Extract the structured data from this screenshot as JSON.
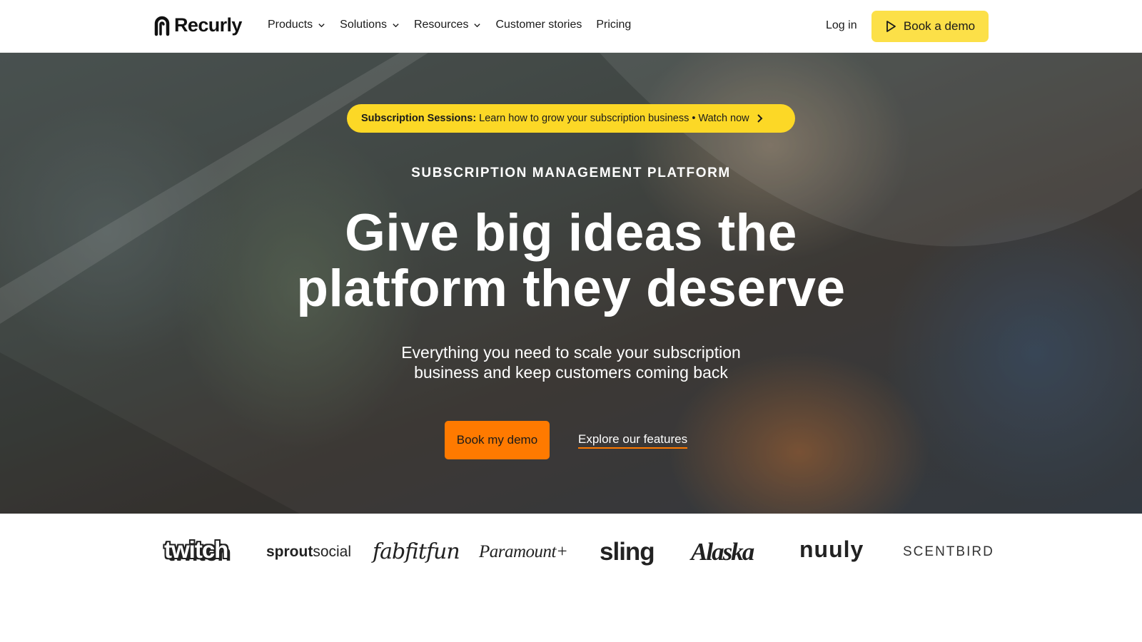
{
  "nav": {
    "logo_text": "Recurly",
    "menu": [
      {
        "label": "Products",
        "dropdown": true
      },
      {
        "label": "Solutions",
        "dropdown": true
      },
      {
        "label": "Resources",
        "dropdown": true
      },
      {
        "label": "Customer stories",
        "dropdown": false
      },
      {
        "label": "Pricing",
        "dropdown": false
      }
    ],
    "login_label": "Log in",
    "demo_label": "Book a demo"
  },
  "hero": {
    "announcement_bold": "Subscription Sessions:",
    "announcement_text": "Learn how to grow your subscription business • Watch now",
    "eyebrow": "SUBSCRIPTION MANAGEMENT PLATFORM",
    "headline_line1": "Give big ideas the",
    "headline_line2": "platform they deserve",
    "subhead_line1": "Everything you need to scale your subscription",
    "subhead_line2": "business and keep customers coming back",
    "primary_cta": "Book my demo",
    "secondary_cta": "Explore our features"
  },
  "logos": {
    "twitch": "twitch",
    "sprout_bold": "sprout",
    "sprout_light": "social",
    "fabfitfun": "fabfitfun",
    "paramount": "Paramount+",
    "sling": "sling",
    "alaska": "Alaska",
    "nuuly": "nuuly",
    "scentbird": "SCENTBIRD"
  },
  "colors": {
    "accent_yellow": "#fce048",
    "announcement_yellow": "#fcd826",
    "cta_orange": "#ff7a00"
  },
  "icons": {
    "logo": "recurly-logo-icon",
    "dropdown": "chevron-down-icon",
    "demo": "play-icon",
    "announcement": "chevron-right-icon"
  }
}
